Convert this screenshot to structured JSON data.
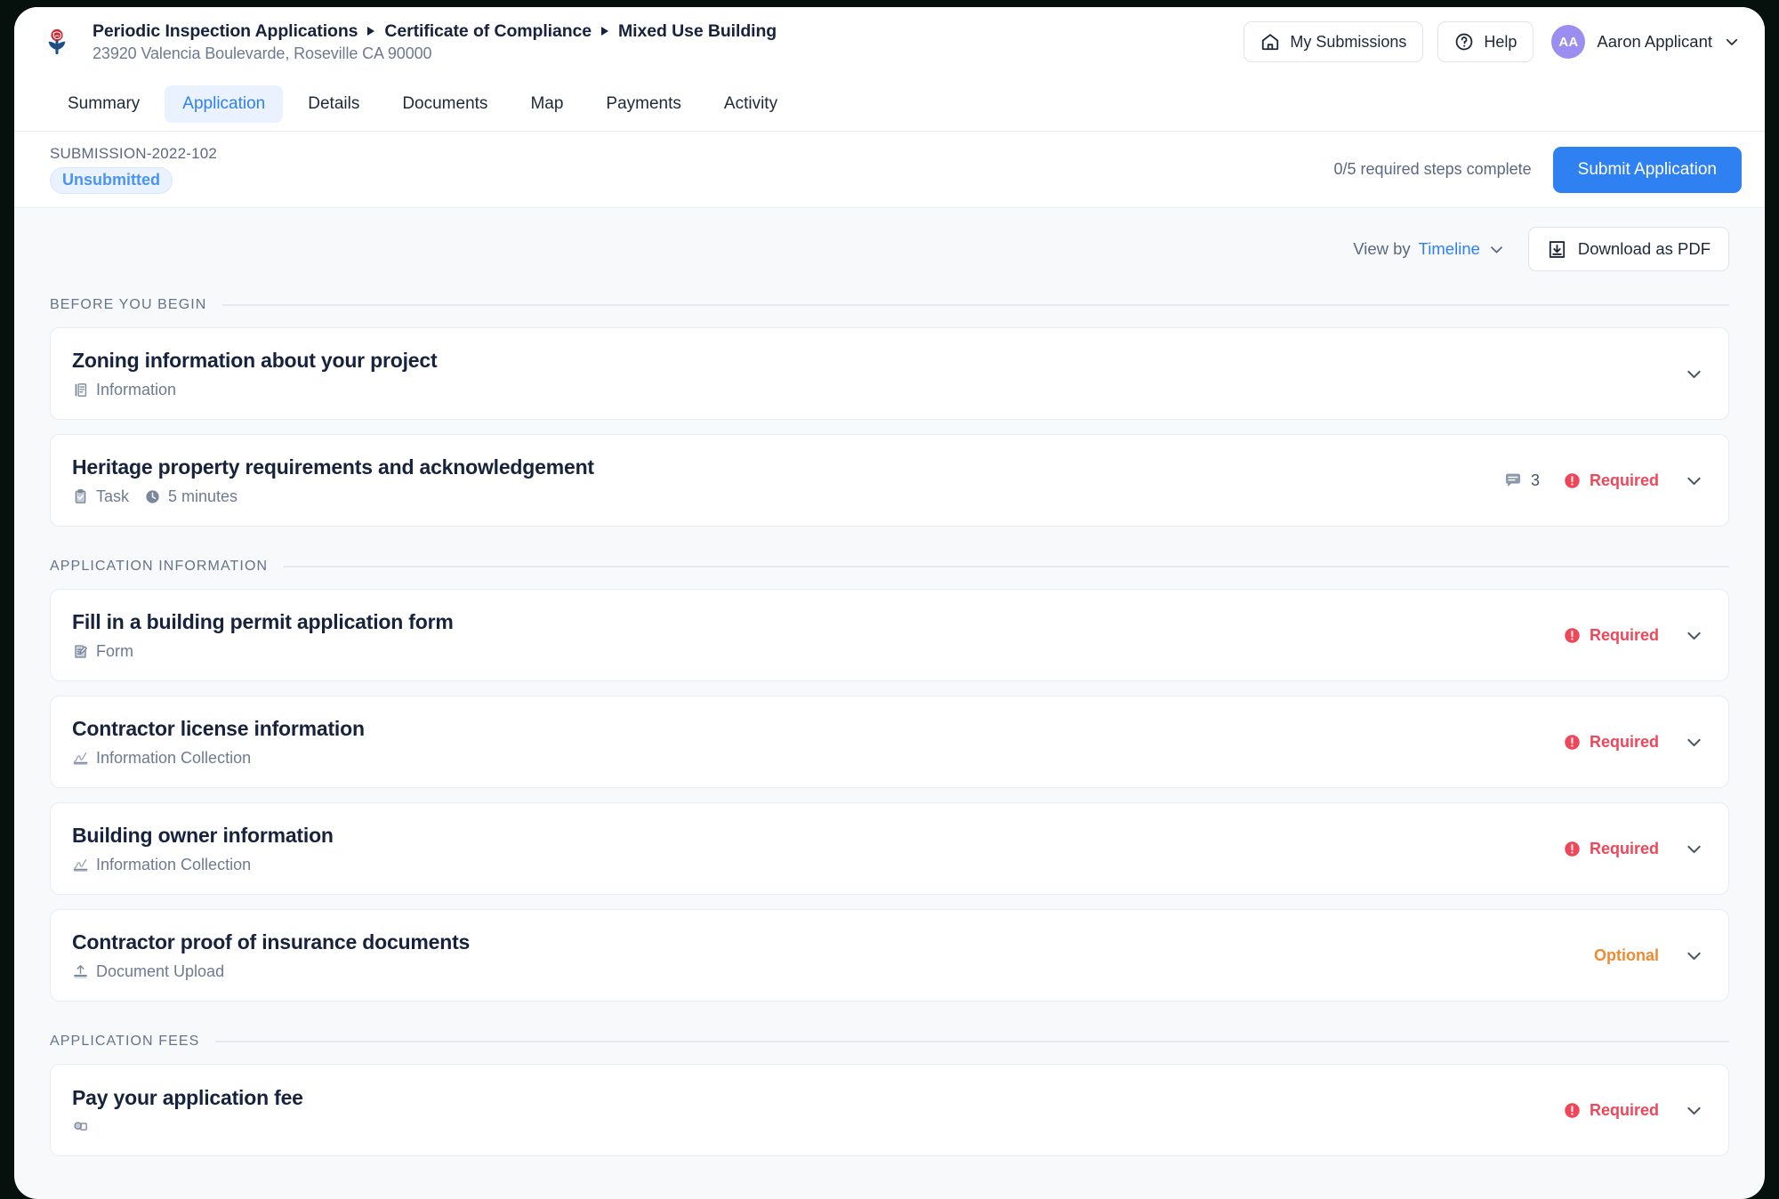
{
  "header": {
    "logo_icon": "rose-logo-icon",
    "breadcrumbs": [
      "Periodic Inspection Applications",
      "Certificate of Compliance",
      "Mixed Use Building"
    ],
    "address": "23920 Valencia Boulevarde, Roseville CA 90000",
    "my_submissions_label": "My Submissions",
    "my_submissions_icon": "home-icon",
    "help_label": "Help",
    "help_icon": "question-circle-icon",
    "user": {
      "initials": "AA",
      "name": "Aaron Applicant",
      "chevron_icon": "chevron-down-icon"
    }
  },
  "tabs": [
    {
      "label": "Summary",
      "active": false
    },
    {
      "label": "Application",
      "active": true
    },
    {
      "label": "Details",
      "active": false
    },
    {
      "label": "Documents",
      "active": false
    },
    {
      "label": "Map",
      "active": false
    },
    {
      "label": "Payments",
      "active": false
    },
    {
      "label": "Activity",
      "active": false
    }
  ],
  "submission": {
    "id": "SUBMISSION-2022-102",
    "status": "Unsubmitted",
    "steps_complete": "0/5 required steps complete",
    "submit_label": "Submit Application"
  },
  "toolbar": {
    "view_by_label": "View by",
    "view_by_value": "Timeline",
    "view_by_chevron_icon": "chevron-down-icon",
    "download_label": "Download as PDF",
    "download_icon": "download-box-icon"
  },
  "sections": [
    {
      "title": "BEFORE YOU BEGIN",
      "cards": [
        {
          "title": "Zoning information about your project",
          "type_label": "Information",
          "type_icon": "information-panel-icon",
          "duration": null,
          "comments": null,
          "badge": null,
          "chevron_icon": "chevron-down-icon"
        },
        {
          "title": "Heritage property requirements and acknowledgement",
          "type_label": "Task",
          "type_icon": "clipboard-check-icon",
          "duration": "5 minutes",
          "duration_icon": "clock-icon",
          "comments": "3",
          "comments_icon": "comment-bubble-icon",
          "badge": "Required",
          "badge_kind": "required",
          "badge_icon": "alert-circle-icon",
          "chevron_icon": "chevron-down-icon"
        }
      ]
    },
    {
      "title": "APPLICATION INFORMATION",
      "cards": [
        {
          "title": "Fill in a building permit application form",
          "type_label": "Form",
          "type_icon": "form-pencil-icon",
          "duration": null,
          "comments": null,
          "badge": "Required",
          "badge_kind": "required",
          "badge_icon": "alert-circle-icon",
          "chevron_icon": "chevron-down-icon"
        },
        {
          "title": "Contractor license information",
          "type_label": "Information Collection",
          "type_icon": "signature-icon",
          "duration": null,
          "comments": null,
          "badge": "Required",
          "badge_kind": "required",
          "badge_icon": "alert-circle-icon",
          "chevron_icon": "chevron-down-icon"
        },
        {
          "title": "Building owner information",
          "type_label": "Information Collection",
          "type_icon": "signature-icon",
          "duration": null,
          "comments": null,
          "badge": "Required",
          "badge_kind": "required",
          "badge_icon": "alert-circle-icon",
          "chevron_icon": "chevron-down-icon"
        },
        {
          "title": "Contractor proof of insurance documents",
          "type_label": "Document Upload",
          "type_icon": "upload-icon",
          "duration": null,
          "comments": null,
          "badge": "Optional",
          "badge_kind": "optional",
          "badge_icon": null,
          "chevron_icon": "chevron-down-icon"
        }
      ]
    },
    {
      "title": "APPLICATION FEES",
      "cards": [
        {
          "title": "Pay your application fee",
          "type_label": "",
          "type_icon": "payment-icon",
          "duration": null,
          "comments": null,
          "badge": "Required",
          "badge_kind": "required",
          "badge_icon": "alert-circle-icon",
          "chevron_icon": "chevron-down-icon"
        }
      ]
    }
  ],
  "colors": {
    "accent_blue": "#2f80f0",
    "required_red": "#f0465a",
    "optional_orange": "#ef8a33",
    "page_bg": "#f7f9fb",
    "card_bg": "#ffffff",
    "text_dark": "#17233c",
    "text_muted": "#6d7a90",
    "avatar_purple": "#9a8ef0"
  }
}
